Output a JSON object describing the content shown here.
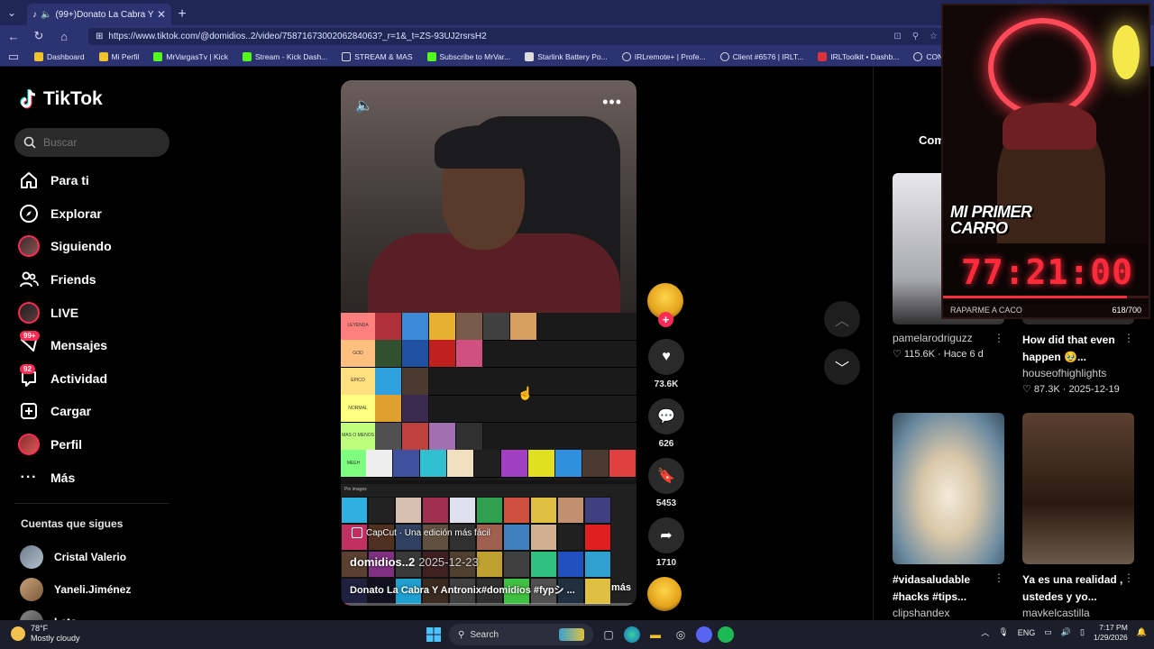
{
  "browser": {
    "tab_title": "(99+)Donato La Cabra Y Antr...",
    "url": "https://www.tiktok.com/@domidios..2/video/7587167300206284063?_r=1&_t=ZS-93UJ2rsrsH2",
    "bookmarks": [
      "Dashboard",
      "Mi Perfil",
      "MrVargasTv | Kick",
      "Stream - Kick Dash...",
      "STREAM & MAS",
      "Subscribe to MrVar...",
      "Starlink Battery Po...",
      "IRLremote+ | Profe...",
      "Client #6576 | IRLT...",
      "IRLToolkit • Dashb...",
      "CONTADOR"
    ]
  },
  "sidebar": {
    "logo": "TikTok",
    "search_placeholder": "Buscar",
    "nav": [
      {
        "label": "Para ti",
        "icon": "home-icon"
      },
      {
        "label": "Explorar",
        "icon": "compass-icon"
      },
      {
        "label": "Siguiendo",
        "icon": "following-avatar-icon"
      },
      {
        "label": "Friends",
        "icon": "friends-icon"
      },
      {
        "label": "LIVE",
        "icon": "live-avatar-icon"
      },
      {
        "label": "Mensajes",
        "icon": "messages-icon",
        "badge": "99+"
      },
      {
        "label": "Actividad",
        "icon": "activity-icon",
        "badge": "92"
      },
      {
        "label": "Cargar",
        "icon": "upload-icon"
      },
      {
        "label": "Perfil",
        "icon": "profile-avatar-icon"
      },
      {
        "label": "Más",
        "icon": "more-icon"
      }
    ],
    "following_title": "Cuentas que sigues",
    "following": [
      "Cristal Valerio",
      "Yaneli.Jiménez",
      "Leto"
    ]
  },
  "video": {
    "tiers": [
      "LEYENDA",
      "GOD",
      "EPICO",
      "NORMAL",
      "MAS O MENOS",
      "MEEH"
    ],
    "pin_label": "Pin images",
    "capcut": "CapCut · Una edición más fácil",
    "author": "domidios..2",
    "date": "2025-12-23",
    "description": "Donato La Cabra Y Antronix#domidios #fypシ ...",
    "more": "más",
    "progress": 0.02
  },
  "actions": {
    "likes": "73.6K",
    "comments": "626",
    "saves": "5453",
    "shares": "1710"
  },
  "right": {
    "comments_tab": "Com",
    "cards": [
      {
        "title": "",
        "user": "pamelarodriguzz",
        "meta": "♡ 115.6K · Hace 6 d"
      },
      {
        "title": "How did that even happen 🥹...",
        "user": "houseofhighlights",
        "meta": "♡ 87.3K · 2025-12-19"
      },
      {
        "title": "#vidasaludable #hacks #tips...",
        "user": "clipshandex",
        "meta": ""
      },
      {
        "title": "Ya es una realidad , ustedes y yo...",
        "user": "mavkelcastilla",
        "meta": ""
      }
    ]
  },
  "overlay": {
    "title_line1": "MI PRIMER",
    "title_line2": "CARRO",
    "timer": "77:21:00",
    "goal_label": "RAPARME A CACO",
    "goal_count": "618/700",
    "goal_progress": 0.88
  },
  "taskbar": {
    "temp": "78°F",
    "weather": "Mostly cloudy",
    "search": "Search",
    "lang": "ENG",
    "time": "7:17 PM",
    "date": "1/29/2026"
  }
}
